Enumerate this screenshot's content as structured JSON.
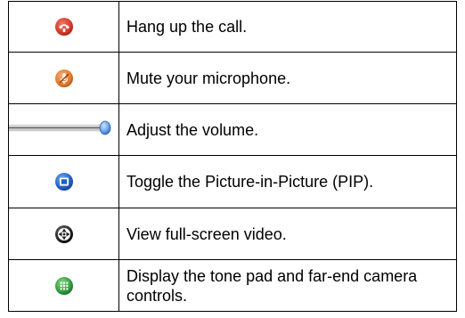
{
  "rows": [
    {
      "icon": "hang-up-icon",
      "text": "Hang up the call."
    },
    {
      "icon": "microphone-mute-icon",
      "text": "Mute your microphone."
    },
    {
      "icon": "volume-slider-icon",
      "text": "Adjust the volume."
    },
    {
      "icon": "pip-toggle-icon",
      "text": "Toggle the Picture-in-Picture (PIP)."
    },
    {
      "icon": "full-screen-icon",
      "text": "View full-screen video."
    },
    {
      "icon": "tone-pad-icon",
      "text": "Display the tone pad and far-end camera controls."
    }
  ],
  "colors": {
    "hang_up": "#d23a2a",
    "mute": "#e07a2a",
    "volume": "#3a7bd8",
    "pip": "#1f5fc2",
    "full_screen": "#222222",
    "tone_pad": "#2f9a3a",
    "border": "#000000"
  }
}
